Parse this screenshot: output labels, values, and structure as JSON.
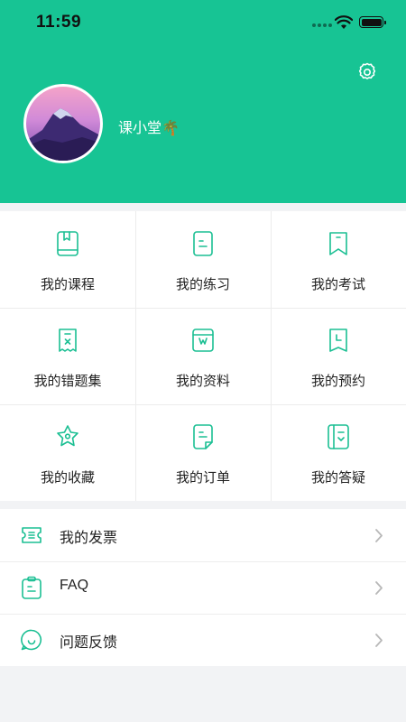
{
  "status_bar": {
    "time": "11:59"
  },
  "profile": {
    "nickname": "课小堂🌴"
  },
  "colors": {
    "accent": "#17c494",
    "icon_stroke": "#1bbf93"
  },
  "menu_grid": [
    {
      "label": "我的课程",
      "icon": "book-icon"
    },
    {
      "label": "我的练习",
      "icon": "practice-doc-icon"
    },
    {
      "label": "我的考试",
      "icon": "exam-bookmark-icon"
    },
    {
      "label": "我的错题集",
      "icon": "wrong-answers-icon"
    },
    {
      "label": "我的资料",
      "icon": "materials-icon"
    },
    {
      "label": "我的预约",
      "icon": "appointment-icon"
    },
    {
      "label": "我的收藏",
      "icon": "favorites-star-icon"
    },
    {
      "label": "我的订单",
      "icon": "order-icon"
    },
    {
      "label": "我的答疑",
      "icon": "qa-notebook-icon"
    }
  ],
  "menu_list": [
    {
      "label": "我的发票",
      "icon": "invoice-ticket-icon"
    },
    {
      "label": "FAQ",
      "icon": "faq-clipboard-icon"
    },
    {
      "label": "问题反馈",
      "icon": "feedback-bubble-icon"
    }
  ]
}
